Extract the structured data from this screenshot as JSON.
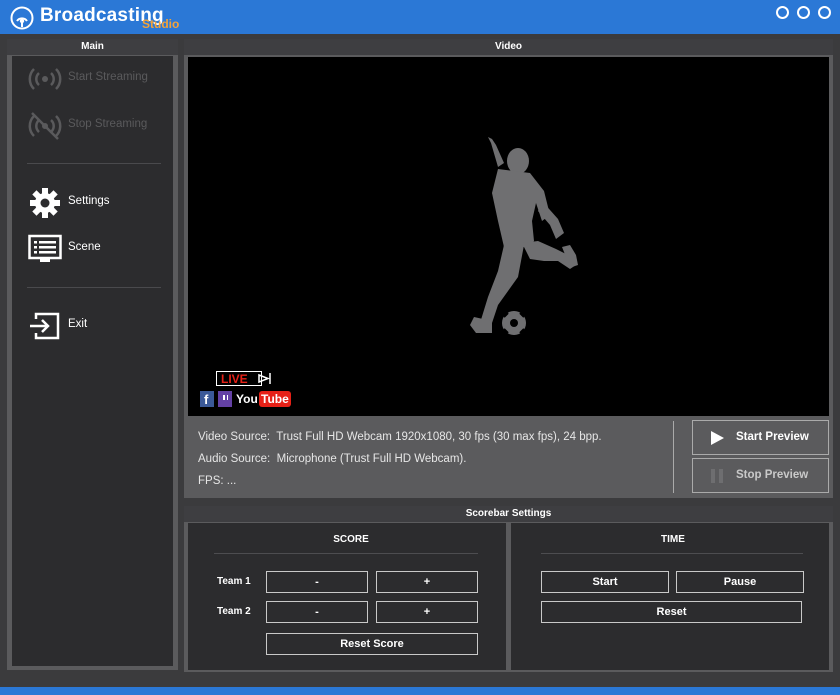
{
  "app": {
    "name": "Broadcasting",
    "sub": "Studio",
    "accent": "#2b78d6",
    "sub_color": "#f2a33a"
  },
  "window_controls": [
    "minimize-icon",
    "maximize-icon",
    "close-icon"
  ],
  "sidebar": {
    "header": "Main",
    "items": [
      {
        "label": "Start Streaming",
        "icon": "broadcast-icon",
        "enabled": false
      },
      {
        "label": "Stop Streaming",
        "icon": "broadcast-off-icon",
        "enabled": false
      },
      {
        "label": "Settings",
        "icon": "gear-icon",
        "enabled": true
      },
      {
        "label": "Scene",
        "icon": "scene-list-icon",
        "enabled": true
      },
      {
        "label": "Exit",
        "icon": "exit-icon",
        "enabled": true
      }
    ]
  },
  "video": {
    "header": "Video",
    "overlay": {
      "live": "LIVE",
      "youtube_you": "You",
      "youtube_tube": "Tube",
      "icons": [
        "facebook-icon",
        "twitch-icon",
        "youtube-icon",
        "camera-icon"
      ]
    },
    "video_source_label": "Video Source:",
    "video_source_value": "Trust Full HD Webcam  1920x1080, 30 fps (30 max fps), 24 bpp.",
    "audio_source_label": "Audio Source:",
    "audio_source_value": "Microphone (Trust Full HD Webcam).",
    "fps_label": "FPS:",
    "fps_value": "...",
    "start_preview": "Start Preview",
    "stop_preview": "Stop Preview"
  },
  "scorebar": {
    "header": "Scorebar Settings",
    "score": {
      "title": "SCORE",
      "team1": "Team 1",
      "team2": "Team 2",
      "minus": "-",
      "plus": "+",
      "reset": "Reset Score"
    },
    "time": {
      "title": "TIME",
      "start": "Start",
      "pause": "Pause",
      "reset": "Reset"
    }
  }
}
